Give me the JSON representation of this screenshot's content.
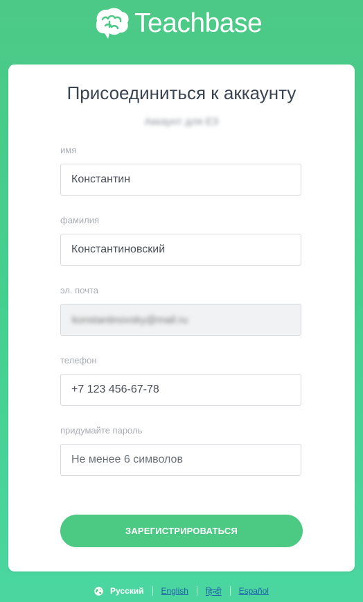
{
  "header": {
    "brand": "Teachbase"
  },
  "form": {
    "title": "Присоединиться к аккаунту",
    "account_name": "Аккаунт для ЕЗ",
    "fields": {
      "first_name": {
        "label": "имя",
        "value": "Константин"
      },
      "last_name": {
        "label": "фамилия",
        "value": "Константиновский"
      },
      "email": {
        "label": "эл. почта",
        "value": "konstantinovsky@mail.ru"
      },
      "phone": {
        "label": "телефон",
        "value": "+7 123 456-67-78"
      },
      "password": {
        "label": "придумайте пароль",
        "placeholder": "Не менее 6 символов"
      }
    },
    "submit_label": "ЗАРЕГИСТРИРОВАТЬСЯ"
  },
  "languages": {
    "current": "Русский",
    "options": [
      "English",
      "हिन्दी",
      "Español"
    ]
  },
  "colors": {
    "brand_green": "#4cc982",
    "link_blue": "#1f5fa8"
  }
}
